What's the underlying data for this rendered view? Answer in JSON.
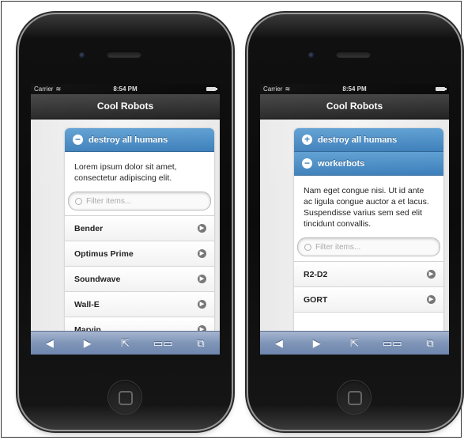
{
  "phones": [
    {
      "status": {
        "carrier": "Carrier",
        "time": "8:54 PM"
      },
      "title": "Cool Robots",
      "sections": [
        {
          "label": "destroy all humans",
          "icon": "minus-circle-icon",
          "expanded": true
        }
      ],
      "body_text": "Lorem ipsum dolor sit amet, consectetur adipiscing elit.",
      "filter_placeholder": "Filter items...",
      "items": [
        "Bender",
        "Optimus Prime",
        "Soundwave",
        "Wall-E",
        "Marvin"
      ]
    },
    {
      "status": {
        "carrier": "Carrier",
        "time": "8:54 PM"
      },
      "title": "Cool Robots",
      "sections": [
        {
          "label": "destroy all humans",
          "icon": "plus-circle-icon",
          "expanded": false
        },
        {
          "label": "workerbots",
          "icon": "minus-circle-icon",
          "expanded": true
        }
      ],
      "body_text": "Nam eget congue nisi. Ut id ante ac ligula congue auctor a et lacus. Suspendisse varius sem sed elit tincidunt convallis.",
      "filter_placeholder": "Filter items...",
      "items": [
        "R2-D2",
        "GORT"
      ]
    }
  ],
  "toolbar_icons": [
    "back-icon",
    "forward-icon",
    "share-icon",
    "bookmarks-icon",
    "tabs-icon"
  ],
  "colors": {
    "accordion_header": "#4a8cc6",
    "toolbar": "#7f95b8"
  }
}
